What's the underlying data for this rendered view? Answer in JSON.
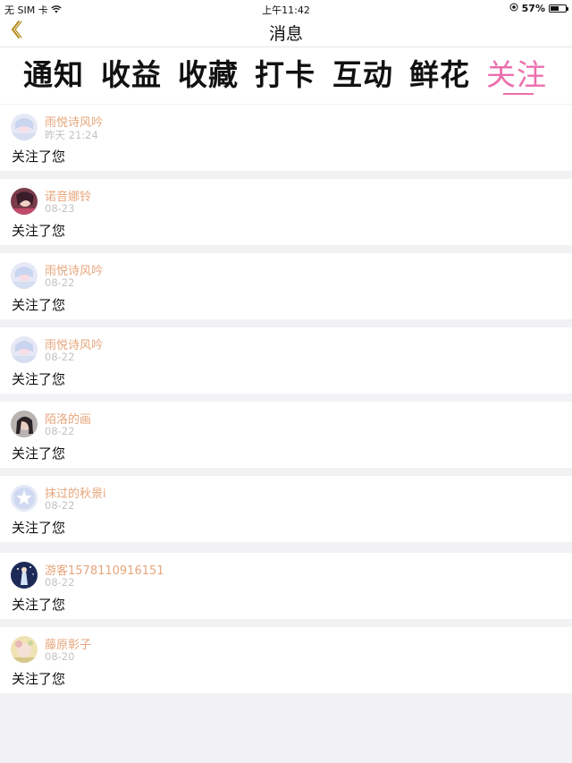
{
  "status_bar": {
    "carrier": "无 SIM 卡",
    "time": "上午11:42",
    "battery": "57%",
    "battery_level": 0.57
  },
  "nav": {
    "title": "消息",
    "back_icon": "chevron-left-icon"
  },
  "tabs": [
    {
      "label": "通知",
      "active": false
    },
    {
      "label": "收益",
      "active": false
    },
    {
      "label": "收藏",
      "active": false
    },
    {
      "label": "打卡",
      "active": false
    },
    {
      "label": "互动",
      "active": false
    },
    {
      "label": "鲜花",
      "active": false
    },
    {
      "label": "关注",
      "active": true
    }
  ],
  "colors": {
    "accent": "#ec6fae",
    "username": "#e7a67c",
    "timestamp": "#c2c2c2",
    "back_icon": "#b38a1b"
  },
  "messages": [
    {
      "user": "雨悦诗风吟",
      "time": "昨天 21:24",
      "text": "关注了您",
      "avatar": "anime-girl-avatar"
    },
    {
      "user": "诺音娜铃",
      "time": "08-23",
      "text": "关注了您",
      "avatar": "anime-character-avatar"
    },
    {
      "user": "雨悦诗风吟",
      "time": "08-22",
      "text": "关注了您",
      "avatar": "anime-girl-avatar"
    },
    {
      "user": "雨悦诗风吟",
      "time": "08-22",
      "text": "关注了您",
      "avatar": "anime-girl-avatar"
    },
    {
      "user": "陌洛的画",
      "time": "08-22",
      "text": "关注了您",
      "avatar": "portrait-avatar"
    },
    {
      "user": "抹过的秋景i",
      "time": "08-22",
      "text": "关注了您",
      "avatar": "default-star-avatar"
    },
    {
      "user": "游客1578110916151",
      "time": "08-22",
      "text": "关注了您",
      "avatar": "night-scene-avatar"
    },
    {
      "user": "藤原彰子",
      "time": "08-20",
      "text": "关注了您",
      "avatar": "flower-avatar"
    }
  ]
}
